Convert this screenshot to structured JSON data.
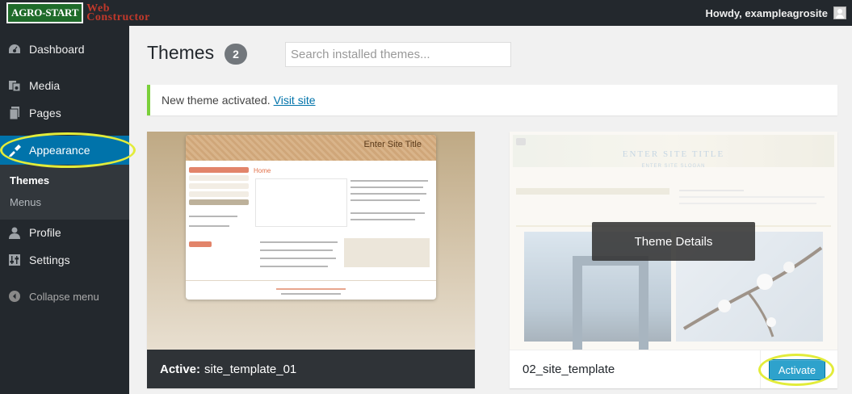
{
  "topbar": {
    "logo_text_1": "AGRO-START",
    "logo_text_2a": "Web",
    "logo_text_2b": "Constructor",
    "howdy": "Howdy, exampleagrosite"
  },
  "sidebar": {
    "items": [
      {
        "label": "Dashboard",
        "icon": "dashboard-icon"
      },
      {
        "label": "Media",
        "icon": "media-icon"
      },
      {
        "label": "Pages",
        "icon": "pages-icon"
      },
      {
        "label": "Appearance",
        "icon": "appearance-icon",
        "active": true
      },
      {
        "label": "Profile",
        "icon": "profile-icon"
      },
      {
        "label": "Settings",
        "icon": "settings-icon"
      }
    ],
    "submenu": [
      "Themes",
      "Menus"
    ],
    "collapse_label": "Collapse menu"
  },
  "main": {
    "title": "Themes",
    "count": "2",
    "search_placeholder": "Search installed themes...",
    "notice_text": "New theme activated.",
    "notice_link": "Visit site"
  },
  "themes": [
    {
      "active_prefix": "Active:",
      "name": "site_template_01",
      "preview": {
        "site_title": "Enter Site Title",
        "heading": "Home"
      }
    },
    {
      "name": "02_site_template",
      "details_label": "Theme Details",
      "activate_label": "Activate",
      "preview": {
        "site_title": "ENTER SITE TITLE",
        "site_slogan": "ENTER SITE SLOGAN"
      }
    }
  ],
  "colors": {
    "admin_bar": "#23282d",
    "menu_active": "#0073aa",
    "notice_border": "#7ad03a",
    "highlight_ring": "#e2ec3a",
    "activate_button": "#2ea2cc"
  }
}
